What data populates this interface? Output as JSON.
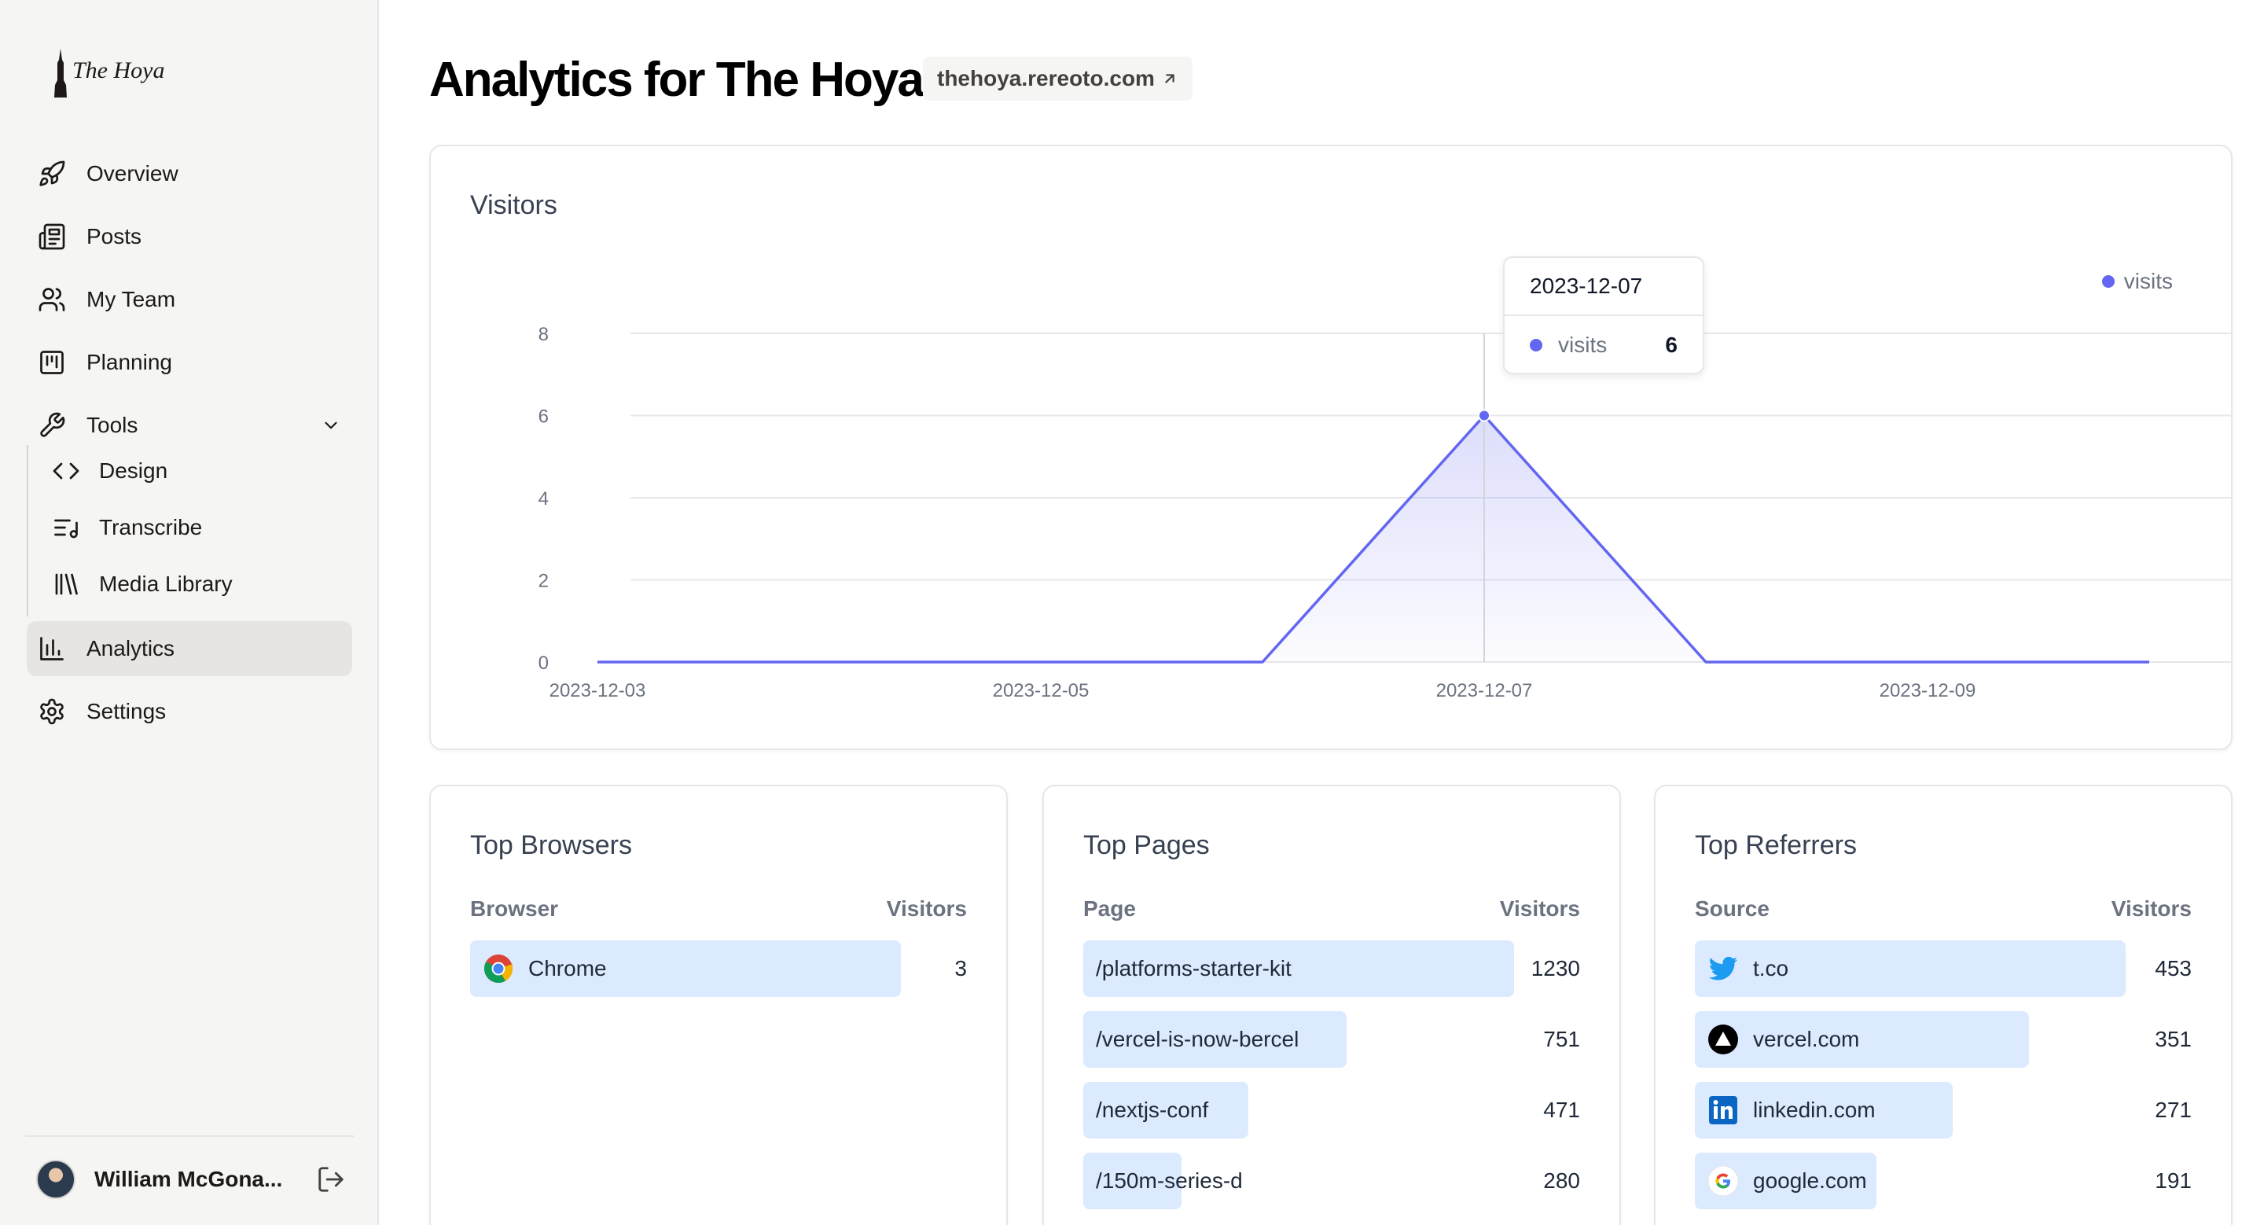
{
  "sidebar": {
    "logo_text": "The Hoya",
    "nav": [
      {
        "label": "Overview",
        "icon": "rocket-icon"
      },
      {
        "label": "Posts",
        "icon": "newspaper-icon"
      },
      {
        "label": "My Team",
        "icon": "users-icon"
      },
      {
        "label": "Planning",
        "icon": "kanban-icon"
      },
      {
        "label": "Tools",
        "icon": "wrench-icon",
        "expanded": true
      }
    ],
    "tools_sub": [
      {
        "label": "Design",
        "icon": "code-icon"
      },
      {
        "label": "Transcribe",
        "icon": "list-music-icon"
      },
      {
        "label": "Media Library",
        "icon": "library-icon"
      }
    ],
    "analytics_label": "Analytics",
    "settings_label": "Settings",
    "user_name": "William McGona..."
  },
  "header": {
    "title": "Analytics for The Hoya",
    "site_link": "thehoya.rereoto.com"
  },
  "visitors": {
    "title": "Visitors",
    "legend": "visits",
    "tooltip": {
      "date": "2023-12-07",
      "label": "visits",
      "value": "6"
    }
  },
  "chart_data": {
    "type": "area",
    "title": "Visitors",
    "x": [
      "2023-12-03",
      "2023-12-04",
      "2023-12-05",
      "2023-12-06",
      "2023-12-07",
      "2023-12-08",
      "2023-12-09",
      "2023-12-10"
    ],
    "series": [
      {
        "name": "visits",
        "values": [
          0,
          0,
          0,
          0,
          6,
          0,
          0,
          0
        ]
      }
    ],
    "x_ticks": [
      "2023-12-03",
      "2023-12-05",
      "2023-12-07",
      "2023-12-09"
    ],
    "y_ticks": [
      0,
      2,
      4,
      6,
      8
    ],
    "ylim": [
      0,
      8
    ],
    "grid": true,
    "legend_position": "top-right",
    "highlight_x": "2023-12-07",
    "color": "#6366f1"
  },
  "browsers": {
    "title": "Top Browsers",
    "col1": "Browser",
    "col2": "Visitors",
    "max": 3,
    "rows": [
      {
        "label": "Chrome",
        "value": 3,
        "icon": "chrome-icon"
      }
    ]
  },
  "pages": {
    "title": "Top Pages",
    "col1": "Page",
    "col2": "Visitors",
    "max": 1230,
    "rows": [
      {
        "label": "/platforms-starter-kit",
        "value": 1230
      },
      {
        "label": "/vercel-is-now-bercel",
        "value": 751
      },
      {
        "label": "/nextjs-conf",
        "value": 471
      },
      {
        "label": "/150m-series-d",
        "value": 280
      }
    ]
  },
  "referrers": {
    "title": "Top Referrers",
    "col1": "Source",
    "col2": "Visitors",
    "max": 453,
    "rows": [
      {
        "label": "t.co",
        "value": 453,
        "icon": "twitter-icon"
      },
      {
        "label": "vercel.com",
        "value": 351,
        "icon": "vercel-icon"
      },
      {
        "label": "linkedin.com",
        "value": 271,
        "icon": "linkedin-icon"
      },
      {
        "label": "google.com",
        "value": 191,
        "icon": "google-icon"
      }
    ]
  }
}
